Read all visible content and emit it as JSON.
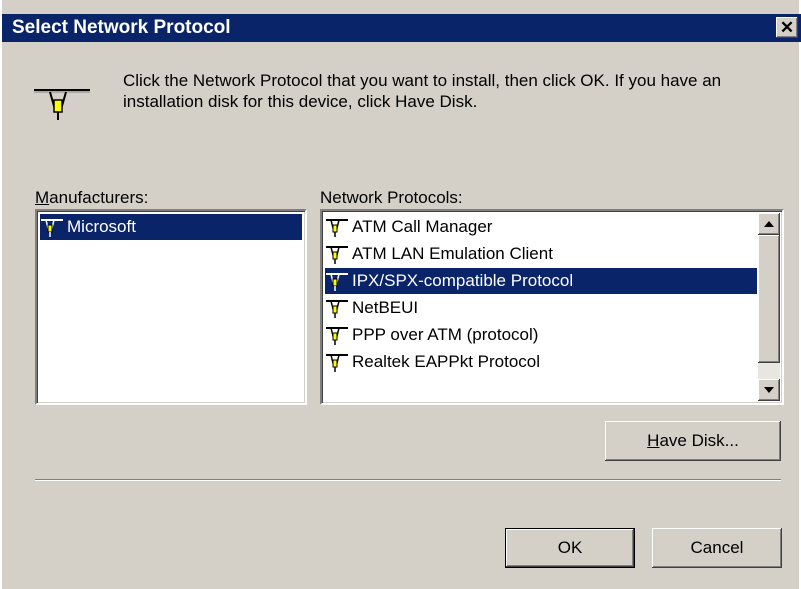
{
  "window": {
    "title": "Select Network Protocol",
    "close_glyph": "✕"
  },
  "instruction": "Click the Network Protocol that you want to install, then click OK. If you have an installation disk for this device, click Have Disk.",
  "manufacturers": {
    "label_underlined": "M",
    "label_rest": "anufacturers:",
    "items": [
      {
        "label": "Microsoft",
        "selected": true,
        "icon": "network-protocol-icon"
      }
    ]
  },
  "protocols": {
    "label": "Network Protocols:",
    "items": [
      {
        "label": "ATM Call Manager",
        "selected": false,
        "icon": "network-protocol-icon"
      },
      {
        "label": "ATM LAN Emulation Client",
        "selected": false,
        "icon": "network-protocol-icon"
      },
      {
        "label": "IPX/SPX-compatible Protocol",
        "selected": true,
        "icon": "network-protocol-icon"
      },
      {
        "label": "NetBEUI",
        "selected": false,
        "icon": "network-protocol-icon"
      },
      {
        "label": "PPP over ATM (protocol)",
        "selected": false,
        "icon": "network-protocol-icon"
      },
      {
        "label": "Realtek EAPPkt Protocol",
        "selected": false,
        "icon": "network-protocol-icon"
      }
    ]
  },
  "buttons": {
    "have_disk_underlined": "H",
    "have_disk_rest": "ave Disk...",
    "ok": "OK",
    "cancel": "Cancel"
  },
  "colors": {
    "title_bar": "#0a246a",
    "face": "#d4d0c8",
    "selection": "#0a246a"
  }
}
